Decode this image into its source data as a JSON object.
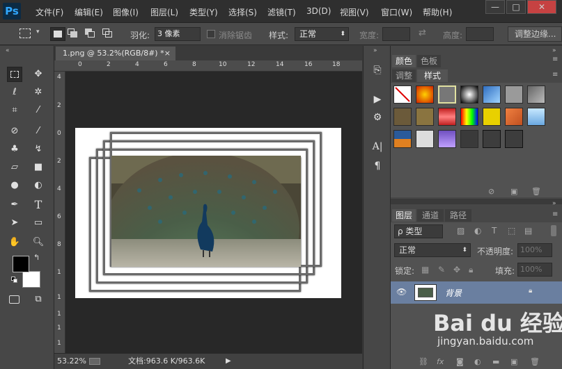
{
  "app": {
    "logo": "Ps"
  },
  "menu": [
    "文件(F)",
    "编辑(E)",
    "图像(I)",
    "图层(L)",
    "类型(Y)",
    "选择(S)",
    "滤镜(T)",
    "3D(D)",
    "视图(V)",
    "窗口(W)",
    "帮助(H)"
  ],
  "window": {
    "minimize": "—",
    "maximize": "□",
    "close": "✕"
  },
  "options": {
    "feather_label": "羽化:",
    "feather_value": "3 像素",
    "antialias_label": "消除锯齿",
    "style_label": "样式:",
    "style_value": "正常",
    "width_label": "宽度:",
    "height_label": "高度:",
    "refine_button": "调整边缘..."
  },
  "document": {
    "tab_title": "1.png @ 53.2%(RGB/8#) *",
    "tab_close": "×"
  },
  "ruler": {
    "top": [
      "0",
      "2",
      "4",
      "6",
      "8",
      "10",
      "12",
      "14",
      "16",
      "18"
    ],
    "left": [
      "4",
      "2",
      "0",
      "2",
      "4",
      "6",
      "8",
      "1",
      "1",
      "1",
      "1",
      "1"
    ]
  },
  "status": {
    "zoom": "53.22%",
    "doc_info": "文档:963.6 K/963.6K"
  },
  "panels": {
    "color_tab": "颜色",
    "swatches_tab": "色板",
    "adjust_tab": "调整",
    "styles_tab": "样式",
    "layers_tab": "图层",
    "channels_tab": "通道",
    "paths_tab": "路径",
    "filter_kind": "ρ 类型",
    "blend_mode": "正常",
    "opacity_label": "不透明度:",
    "opacity_value": "100%",
    "lock_label": "锁定:",
    "fill_label": "填充:",
    "fill_value": "100%",
    "layer_name": "背景"
  },
  "watermark": {
    "brand": "Bai du 经验",
    "url": "jingyan.baidu.com"
  }
}
